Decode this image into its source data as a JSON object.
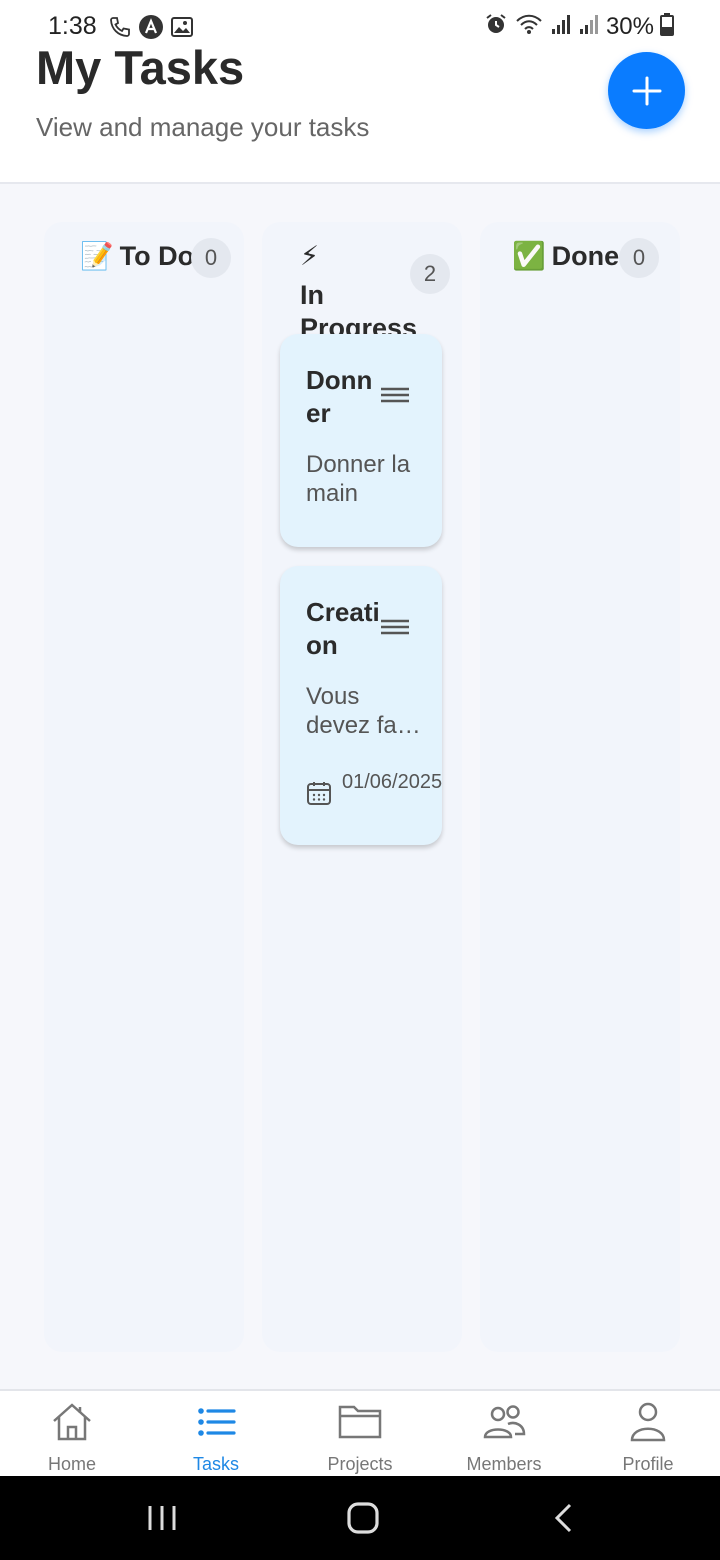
{
  "status_bar": {
    "time": "1:38",
    "battery": "30%",
    "left_icons": [
      "phone-icon",
      "app-icon",
      "image-icon"
    ],
    "right_icons": [
      "alarm-icon",
      "wifi-icon",
      "signal-icon",
      "signal-icon",
      "battery-icon"
    ]
  },
  "header": {
    "title": "My Tasks",
    "subtitle": "View and manage your tasks",
    "add_button_icon": "plus-icon"
  },
  "columns": [
    {
      "emoji": "📝",
      "title": "To Do",
      "count": "0"
    },
    {
      "emoji": "⚡",
      "title": "In Progress",
      "count": "2"
    },
    {
      "emoji": "✅",
      "title": "Done",
      "count": "0"
    }
  ],
  "cards": [
    {
      "title": "Donner",
      "description": "Donner la main",
      "date": ""
    },
    {
      "title": "Creation",
      "description": "Vous devez fa…",
      "date": "01/06/2025"
    }
  ],
  "bottom_nav": [
    {
      "label": "Home",
      "icon": "home-icon",
      "active": false
    },
    {
      "label": "Tasks",
      "icon": "list-icon",
      "active": true
    },
    {
      "label": "Projects",
      "icon": "folder-icon",
      "active": false
    },
    {
      "label": "Members",
      "icon": "members-icon",
      "active": false
    },
    {
      "label": "Profile",
      "icon": "profile-icon",
      "active": false
    }
  ],
  "colors": {
    "accent": "#0a7cff",
    "active_tab": "#1e88e5",
    "card_bg": "#e3f3fd"
  }
}
